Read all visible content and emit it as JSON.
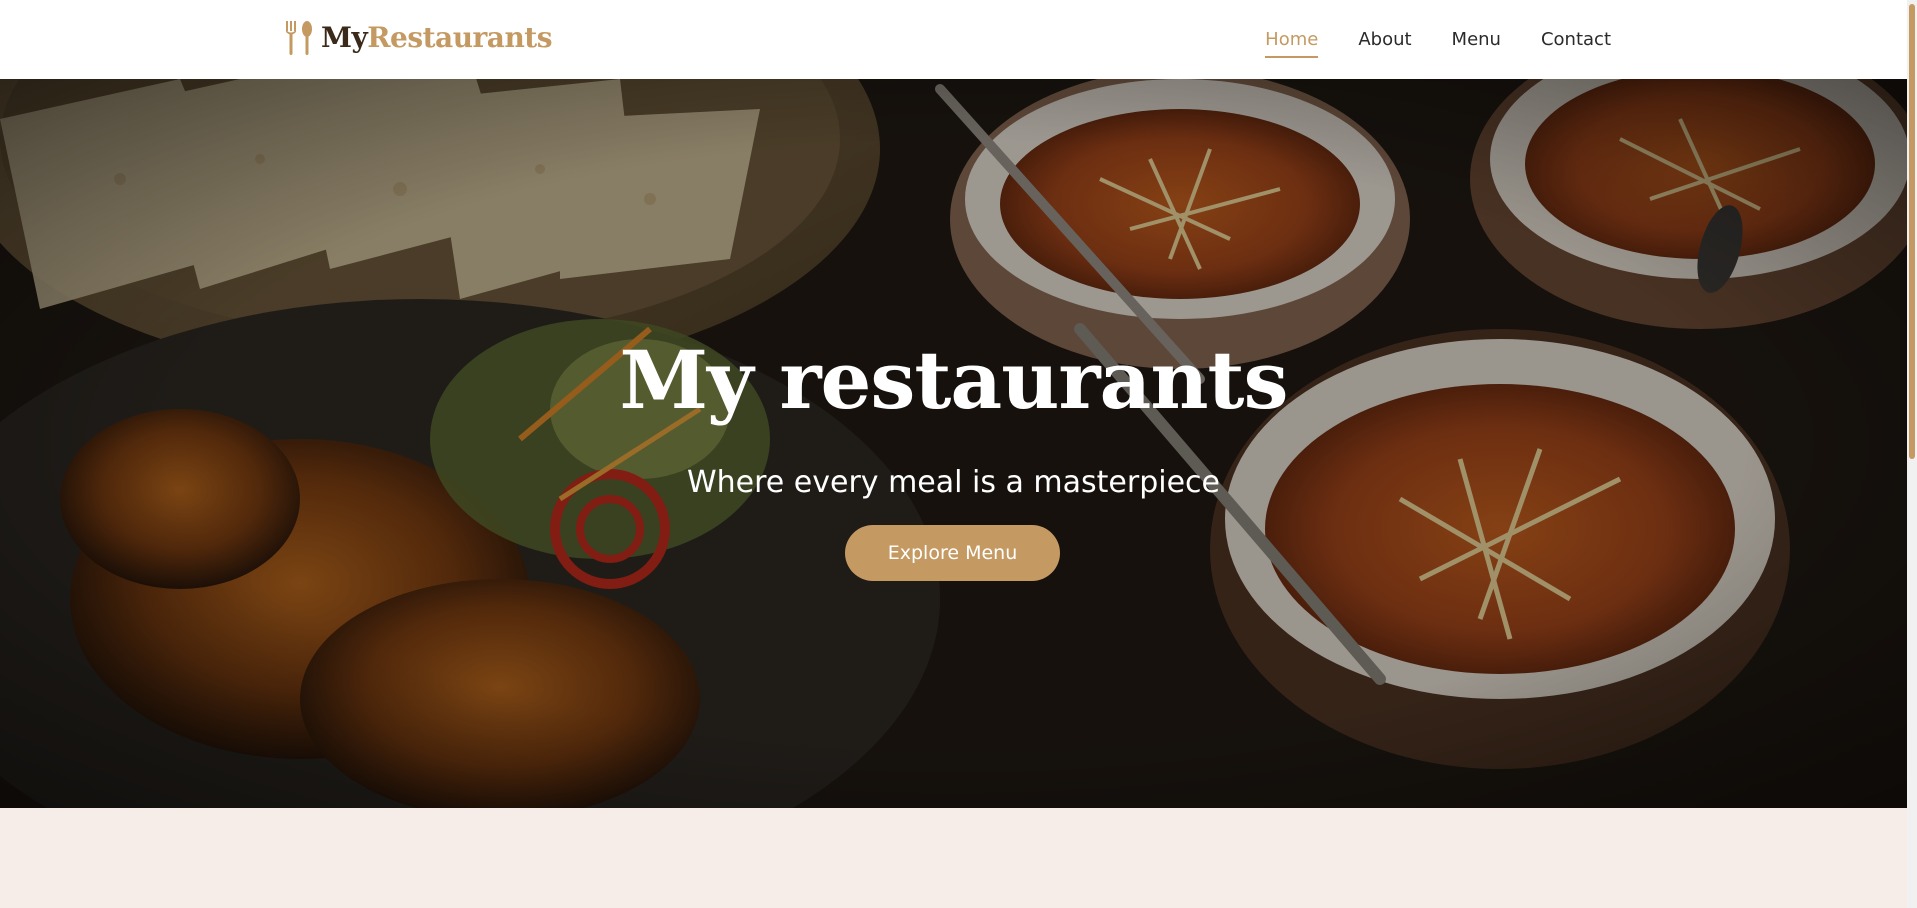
{
  "brand": {
    "name_part1": "My",
    "name_part2": "Restaurants",
    "icon": "fork-spoon-icon",
    "accent_color": "#c49a62",
    "dark_color": "#3b2a1a"
  },
  "nav": {
    "items": [
      {
        "label": "Home",
        "active": true
      },
      {
        "label": "About",
        "active": false
      },
      {
        "label": "Menu",
        "active": false
      },
      {
        "label": "Contact",
        "active": false
      }
    ]
  },
  "hero": {
    "title": "My restaurants",
    "subtitle": "Where every meal is a masterpiece",
    "button_label": "Explore Menu"
  },
  "colors": {
    "section_background": "#f6ede8"
  }
}
